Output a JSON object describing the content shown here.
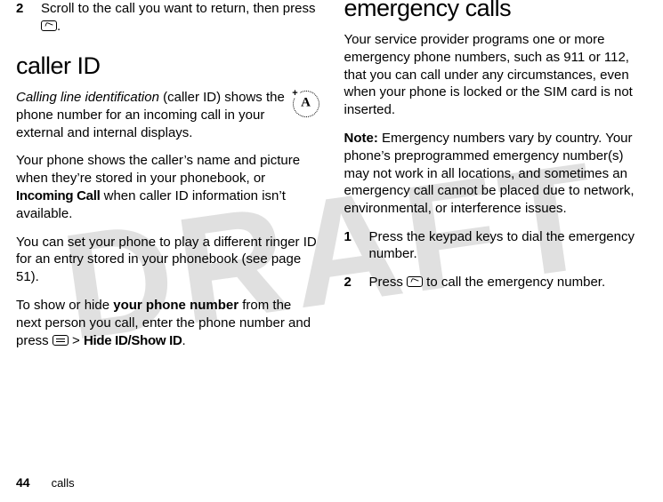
{
  "watermark": "DRAFT",
  "left": {
    "step2_num": "2",
    "step2_text_a": "Scroll to the call you want to return, then press ",
    "step2_text_b": ".",
    "h_callerid": "caller ID",
    "p1_a": "Calling line identification",
    "p1_b": " (caller ID) shows the phone number for an incoming call in your external and internal displays.",
    "p2_a": "Your phone shows the caller’s name and picture when they’re stored in your phonebook, or ",
    "p2_b": "Incoming Call",
    "p2_c": " when caller ID information isn’t available.",
    "p3": "You can set your phone to play a different ringer ID for an entry stored in your phonebook (see page 51).",
    "p4_a": "To show or hide ",
    "p4_b": "your phone number",
    "p4_c": " from the next person you call, enter the phone number and press ",
    "p4_d": " > ",
    "p4_e": "Hide ID/Show ID",
    "p4_f": "."
  },
  "right": {
    "h_emergency": "emergency calls",
    "p1": "Your service provider programs one or more emergency phone numbers, such as 911 or 112, that you can call under any circumstances, even when your phone is locked or the SIM card is not inserted.",
    "p2_a": "Note:",
    "p2_b": " Emergency numbers vary by country. Your phone’s preprogrammed emergency number(s) may not work in all locations, and sometimes an emergency call cannot be placed due to network, environmental, or interference issues.",
    "step1_num": "1",
    "step1_text": "Press the keypad keys to dial the emergency number.",
    "step2_num": "2",
    "step2_text_a": "Press ",
    "step2_text_b": " to call the emergency number."
  },
  "footer": {
    "page": "44",
    "section": "calls"
  }
}
